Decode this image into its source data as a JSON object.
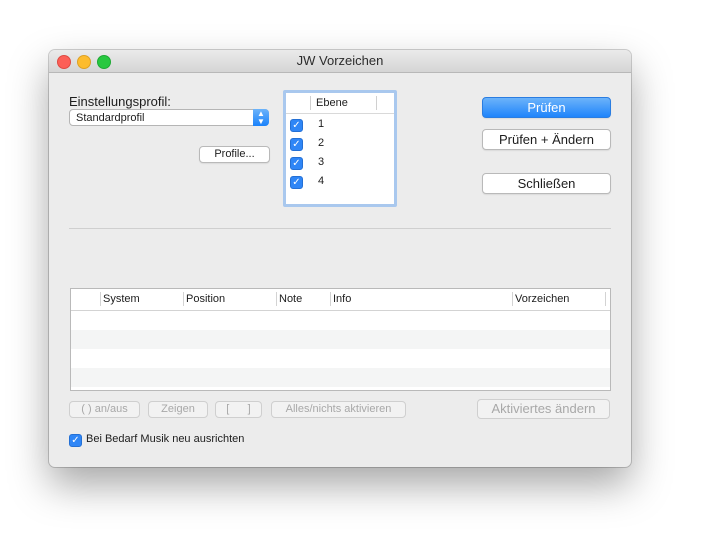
{
  "window": {
    "title": "JW Vorzeichen"
  },
  "settings": {
    "label": "Einstellungsprofil:",
    "profile_value": "Standardprofil",
    "profiles_button": "Profile..."
  },
  "layers": {
    "header": "Ebene",
    "rows": [
      {
        "label": "1",
        "checked": true
      },
      {
        "label": "2",
        "checked": true
      },
      {
        "label": "3",
        "checked": true
      },
      {
        "label": "4",
        "checked": true
      }
    ]
  },
  "actions": {
    "check": "Prüfen",
    "check_change": "Prüfen + Ändern",
    "close": "Schließen"
  },
  "results": {
    "columns": [
      "System",
      "Position",
      "Note",
      "Info",
      "Vorzeichen"
    ],
    "rows": []
  },
  "bottom_buttons": {
    "toggle": "( ) an/aus",
    "show": "Zeigen",
    "brackets": "[      ]",
    "all_none": "Alles/nichts aktivieren",
    "change_active": "Aktiviertes ändern"
  },
  "options": {
    "realign_label": "Bei Bedarf Musik neu ausrichten",
    "realign_checked": true
  },
  "colors": {
    "accent": "#1f84fb",
    "window_bg": "#ececec"
  }
}
